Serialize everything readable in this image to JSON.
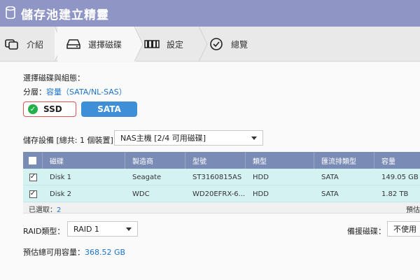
{
  "window": {
    "title": "儲存池建立精靈"
  },
  "steps": [
    {
      "label": "介紹",
      "icon": "stack-icon"
    },
    {
      "label": "選擇磁碟",
      "icon": "disk-icon"
    },
    {
      "label": "設定",
      "icon": "settings-icon"
    },
    {
      "label": "總覽",
      "icon": "check-circle-icon"
    }
  ],
  "disk_select": {
    "heading": "選擇磁碟與組態：",
    "tier_label": "分層：",
    "tier_value": "容量（SATA/NL-SAS）",
    "ssd_label": "SSD",
    "sata_label": "SATA"
  },
  "device": {
    "label": "儲存設備 [總共: 1 個裝置]:",
    "selected": "NAS主機 [2/4 可用磁碟]"
  },
  "table": {
    "headers": [
      "磁碟",
      "製造商",
      "型號",
      "類型",
      "匯流排類型",
      "容量"
    ],
    "rows": [
      {
        "checked": "☑",
        "disk": "Disk 1",
        "vendor": "Seagate",
        "model": "ST3160815AS",
        "type": "HDD",
        "bus": "SATA",
        "capacity": "149.05 GB"
      },
      {
        "checked": "☑",
        "disk": "Disk 2",
        "vendor": "WDC",
        "model": "WD20EFRX-6...",
        "type": "HDD",
        "bus": "SATA",
        "capacity": "1.82 TB"
      }
    ],
    "selected_label": "已選取：",
    "selected_count": "2",
    "footer_right": "預估"
  },
  "raid": {
    "label": "RAID類型：",
    "selected": "RAID 1",
    "spare_label": "備援磁碟：",
    "spare_selected": "不使用"
  },
  "estimate": {
    "label": "預估總可用容量：",
    "value": "368.52 GB"
  }
}
